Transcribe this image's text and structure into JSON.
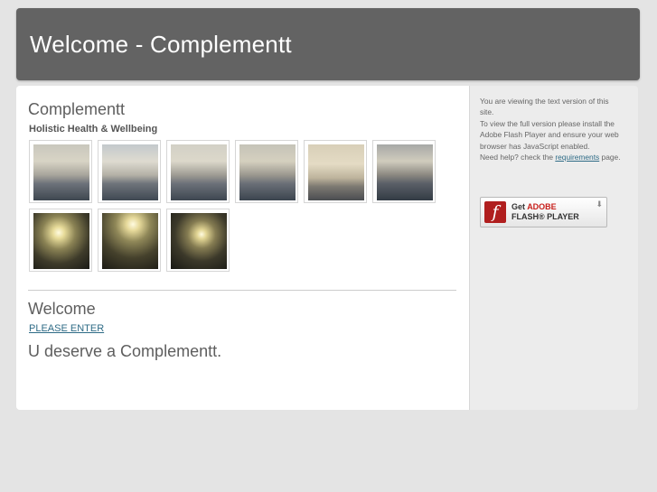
{
  "header": {
    "title": "Welcome - Complementt"
  },
  "main": {
    "site_title": "Complementt",
    "tagline": "Holistic Health & Wellbeing",
    "gallery": {
      "thumbnails": [
        {
          "name": "sunrays-clouds-photo-1"
        },
        {
          "name": "sunrays-clouds-photo-2"
        },
        {
          "name": "sunrays-clouds-photo-3"
        },
        {
          "name": "sunrays-clouds-photo-4"
        },
        {
          "name": "sunrays-clouds-photo-5"
        },
        {
          "name": "sunrays-clouds-photo-6"
        },
        {
          "name": "sunset-sea-photo-1"
        },
        {
          "name": "sunset-sea-photo-2"
        },
        {
          "name": "sunset-sea-photo-3"
        }
      ]
    },
    "welcome_heading": "Welcome",
    "enter_link": "PLEASE ENTER",
    "slogan": "U deserve a Complementt."
  },
  "sidebar": {
    "line1": "You are viewing the text version of this site.",
    "line2": "To view the full version please install the Adobe Flash Player and ensure your web browser has JavaScript enabled.",
    "help_prefix": "Need help? check the ",
    "help_link": "requirements",
    "help_suffix": " page.",
    "flash_badge": {
      "get": "Get",
      "adobe": "ADOBE",
      "player": "FLASH® PLAYER",
      "icon": "flash-f-icon"
    }
  }
}
